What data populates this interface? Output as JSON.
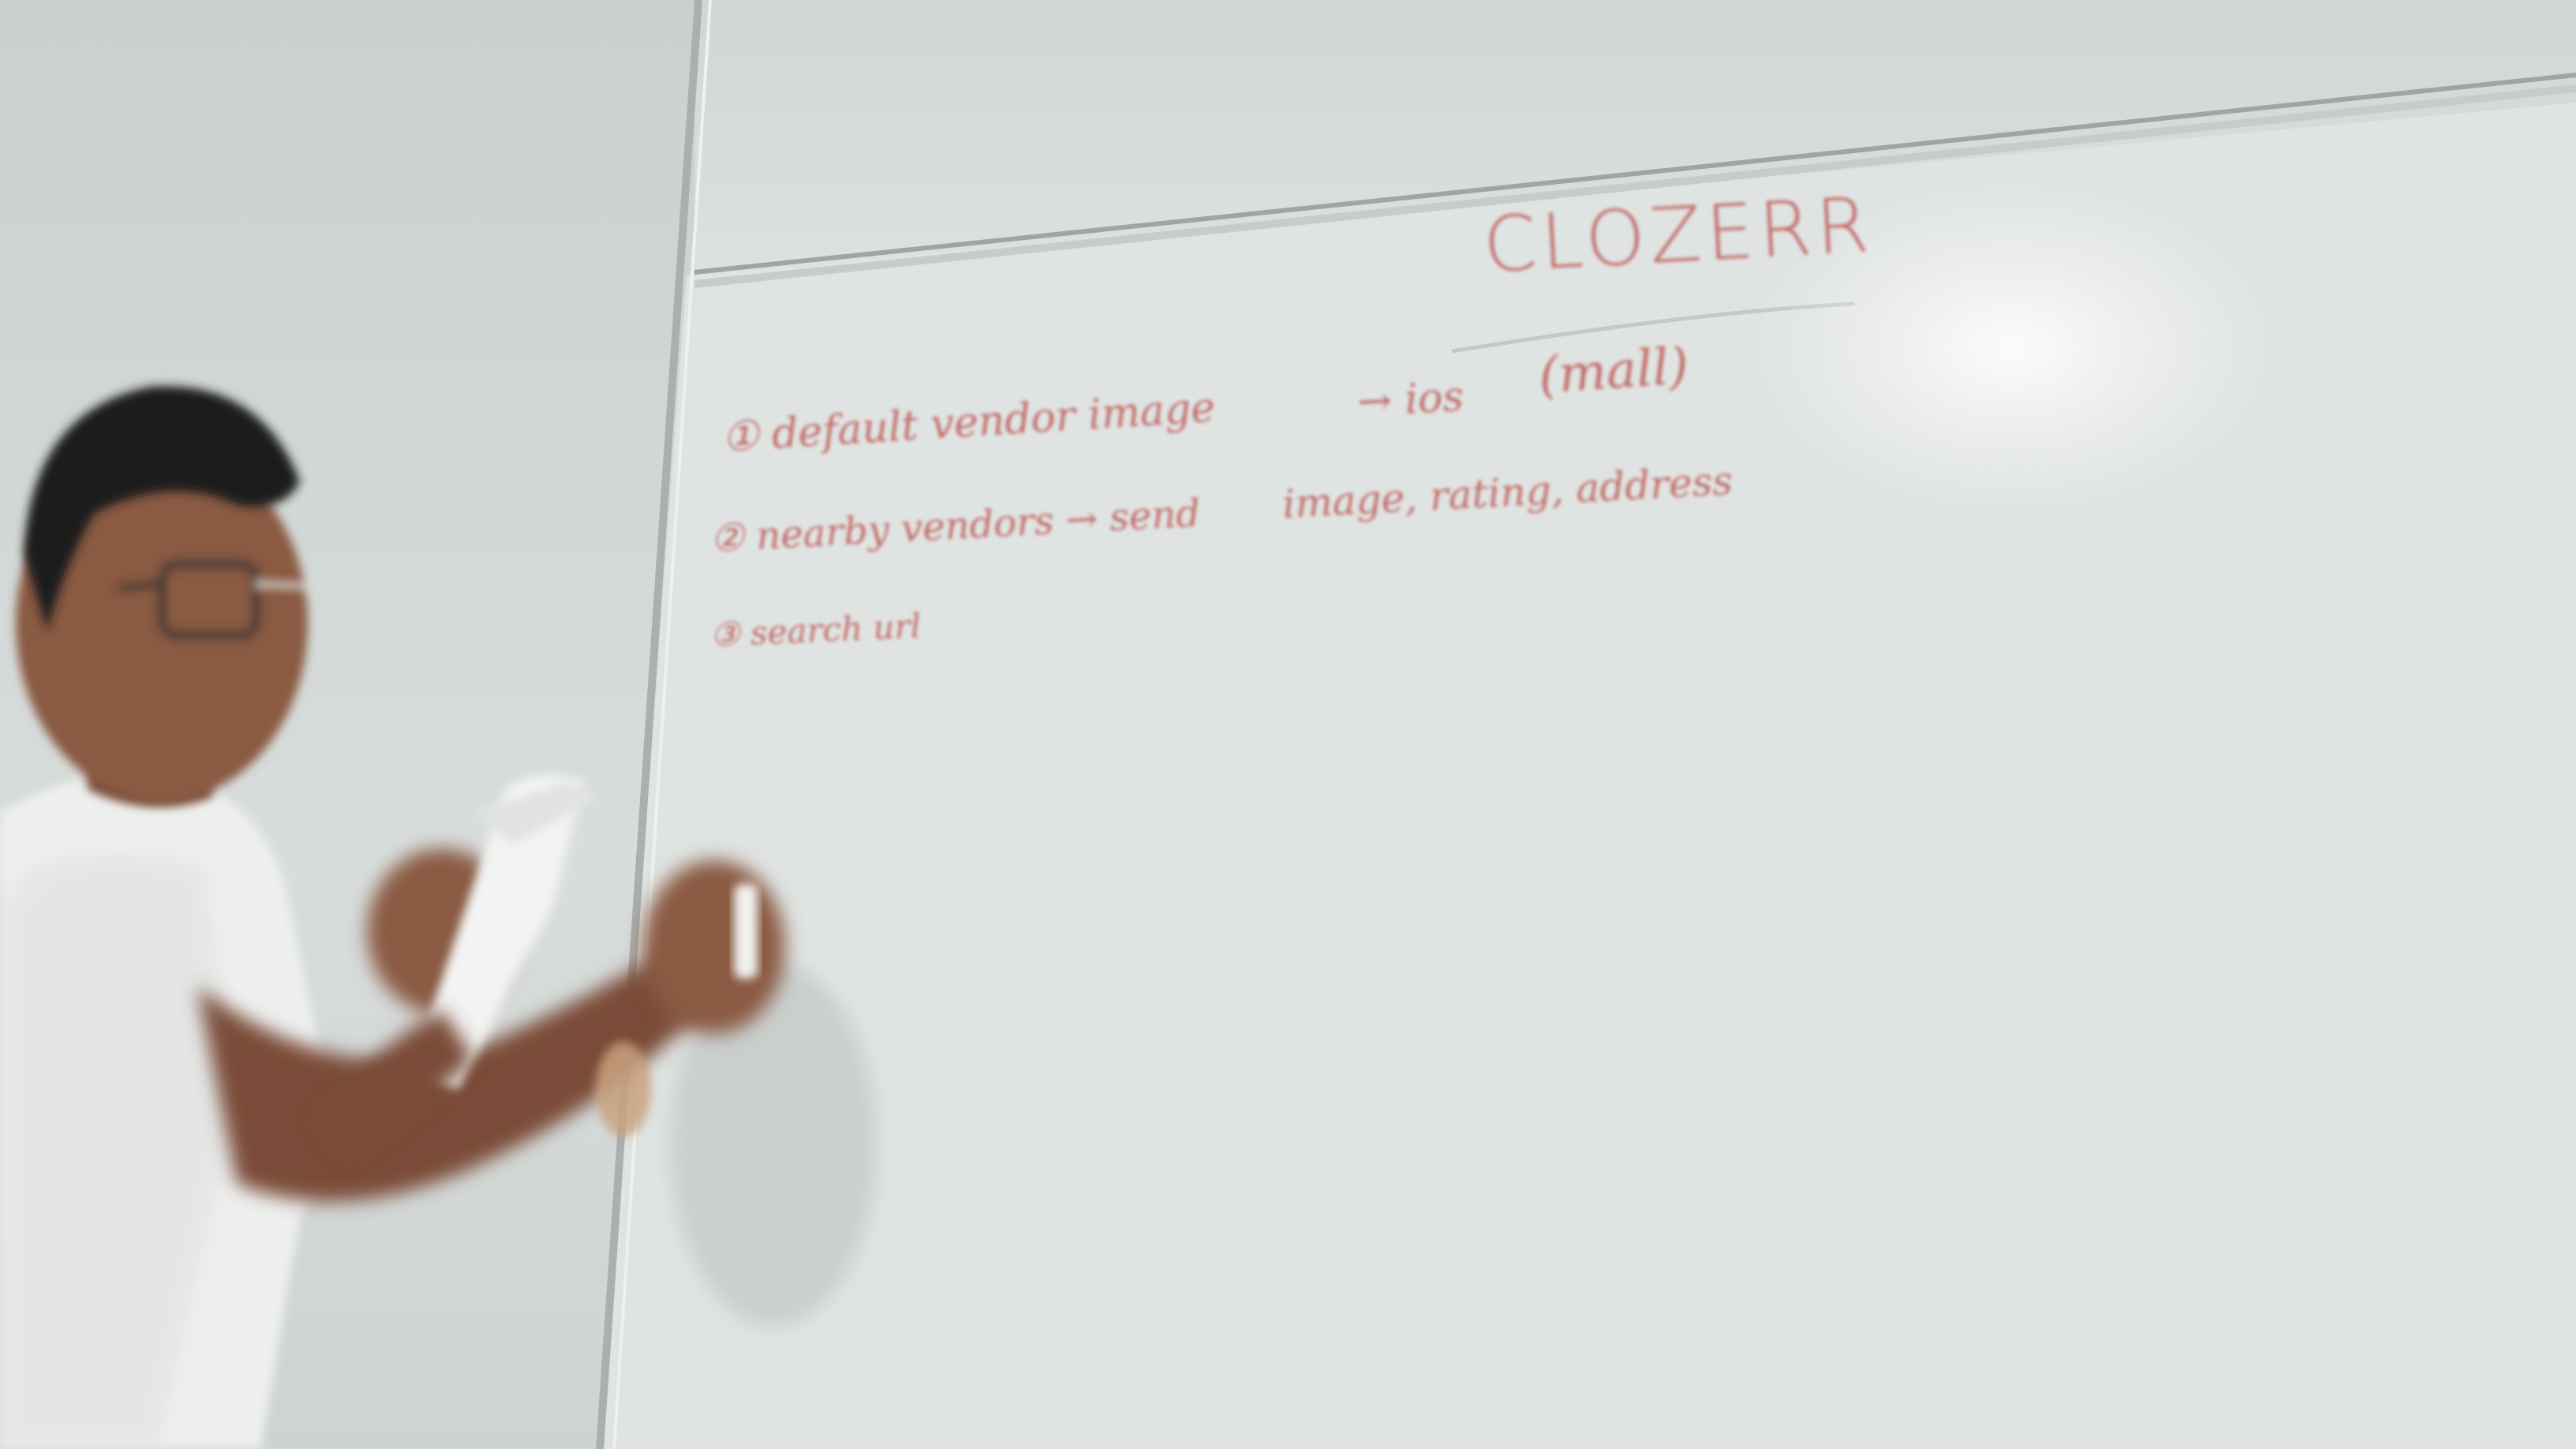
{
  "whiteboard": {
    "title": "CLOZERR",
    "note": "(mall)",
    "items": [
      {
        "text": "① default vendor image",
        "continuation": "→ ios"
      },
      {
        "text": "② nearby vendors → send",
        "continuation": "image, rating, address"
      },
      {
        "text": "③ search url"
      }
    ]
  },
  "colors": {
    "marker": "#c0625e",
    "board": "#dfe3e2",
    "wall": "#cdd3d2",
    "shirt": "#eef0ef",
    "skin": "#8a5a43",
    "hair": "#1e1b1a"
  }
}
